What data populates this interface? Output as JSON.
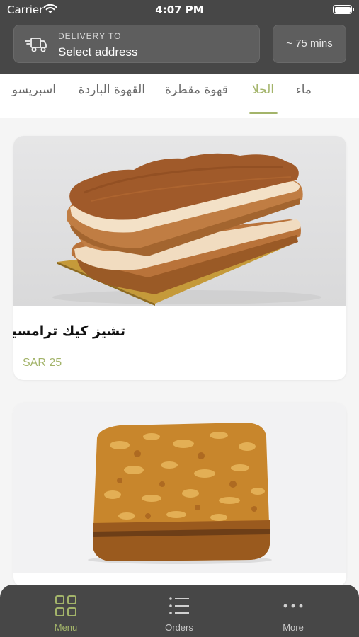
{
  "status_bar": {
    "carrier": "Carrier",
    "time": "4:07 PM"
  },
  "header": {
    "delivery_label": "DELIVERY TO",
    "delivery_value": "Select address",
    "eta": "~ 75 mins"
  },
  "tabs": [
    {
      "label": "ماء",
      "active": false
    },
    {
      "label": "الحلا",
      "active": true
    },
    {
      "label": "قهوة مقطرة",
      "active": false
    },
    {
      "label": "القهوة الباردة",
      "active": false
    },
    {
      "label": "اسبريسو",
      "active": false
    }
  ],
  "products": [
    {
      "name": "تشيز كيك ترامسيو",
      "price": "SAR 25",
      "image": "tiramisu-cheesecake"
    },
    {
      "name": "",
      "price": "",
      "image": "oat-crumble-bar"
    }
  ],
  "bottom_nav": {
    "items": [
      {
        "label": "Menu",
        "icon": "grid-icon",
        "active": true
      },
      {
        "label": "Orders",
        "icon": "list-icon",
        "active": false
      },
      {
        "label": "More",
        "icon": "more-icon",
        "active": false
      }
    ]
  },
  "colors": {
    "accent": "#a3b46a",
    "header_bg": "#474747",
    "box_bg": "#5e5e5e"
  }
}
